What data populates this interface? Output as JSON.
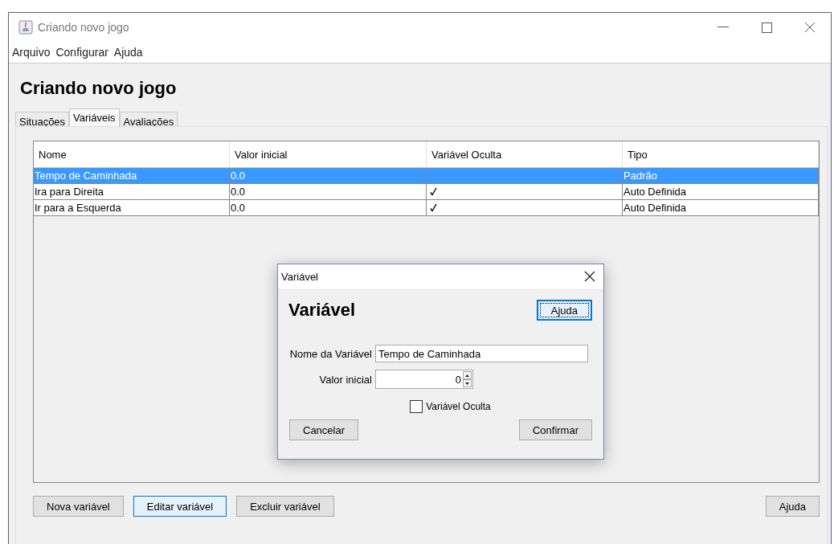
{
  "window": {
    "title": "Criando novo jogo"
  },
  "menu": [
    "Arquivo",
    "Configurar",
    "Ajuda"
  ],
  "heading": "Criando novo jogo",
  "tabs": [
    {
      "label": "Situações",
      "selected": false
    },
    {
      "label": "Variáveis",
      "selected": true
    },
    {
      "label": "Avaliações",
      "selected": false
    }
  ],
  "table": {
    "columns": [
      "Nome",
      "Valor inicial",
      "Variável Oculta",
      "Tipo"
    ],
    "rows": [
      {
        "name": "Tempo de Caminhada",
        "initial_value": "0.0",
        "hidden": false,
        "type": "Padrão",
        "selected": true
      },
      {
        "name": "Ira para Direita",
        "initial_value": "0.0",
        "hidden": true,
        "type": "Auto Definida",
        "selected": false
      },
      {
        "name": "Ir para a Esquerda",
        "initial_value": "0.0",
        "hidden": true,
        "type": "Auto Definida",
        "selected": false
      }
    ]
  },
  "buttons": [
    {
      "label": "Nova variável",
      "focused": false
    },
    {
      "label": "Editar variável",
      "focused": true
    },
    {
      "label": "Excluir variável",
      "focused": false
    }
  ],
  "help_button": {
    "label": "Ajuda",
    "focused": false
  },
  "dialog": {
    "title": "Variável",
    "heading": "Variável",
    "help_button": {
      "label": "Ajuda",
      "focused": true
    },
    "name_label": "Nome da Variável",
    "name_value": "Tempo de Caminhada",
    "initial_label": "Valor inicial",
    "initial_value": "0",
    "hidden_checkbox": {
      "label": "Variável Oculta",
      "checked": false
    },
    "cancel": "Cancelar",
    "confirm": "Confirmar"
  }
}
